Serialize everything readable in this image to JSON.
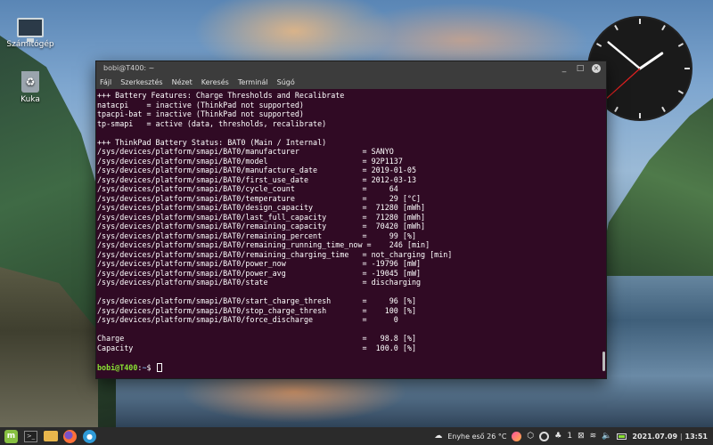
{
  "desktop": {
    "icons": [
      {
        "label": "Számítógép",
        "icon": "computer-icon"
      },
      {
        "label": "Kuka",
        "icon": "trash-icon"
      }
    ]
  },
  "window": {
    "title": "bobi@T400: ~",
    "controls": {
      "minimize": "_",
      "maximize": "□",
      "close": "×"
    },
    "menu": [
      "Fájl",
      "Szerkesztés",
      "Nézet",
      "Keresés",
      "Terminál",
      "Súgó"
    ]
  },
  "terminal": {
    "lines": [
      "+++ Battery Features: Charge Thresholds and Recalibrate",
      "natacpi    = inactive (ThinkPad not supported)",
      "tpacpi-bat = inactive (ThinkPad not supported)",
      "tp-smapi   = active (data, thresholds, recalibrate)",
      "",
      "+++ ThinkPad Battery Status: BAT0 (Main / Internal)",
      "/sys/devices/platform/smapi/BAT0/manufacturer              = SANYO",
      "/sys/devices/platform/smapi/BAT0/model                     = 92P1137",
      "/sys/devices/platform/smapi/BAT0/manufacture_date          = 2019-01-05",
      "/sys/devices/platform/smapi/BAT0/first_use_date            = 2012-03-13",
      "/sys/devices/platform/smapi/BAT0/cycle_count               =     64",
      "/sys/devices/platform/smapi/BAT0/temperature               =     29 [°C]",
      "/sys/devices/platform/smapi/BAT0/design_capacity           =  71280 [mWh]",
      "/sys/devices/platform/smapi/BAT0/last_full_capacity        =  71280 [mWh]",
      "/sys/devices/platform/smapi/BAT0/remaining_capacity        =  70420 [mWh]",
      "/sys/devices/platform/smapi/BAT0/remaining_percent         =     99 [%]",
      "/sys/devices/platform/smapi/BAT0/remaining_running_time_now =    246 [min]",
      "/sys/devices/platform/smapi/BAT0/remaining_charging_time   = not_charging [min]",
      "/sys/devices/platform/smapi/BAT0/power_now                 = -19796 [mW]",
      "/sys/devices/platform/smapi/BAT0/power_avg                 = -19045 [mW]",
      "/sys/devices/platform/smapi/BAT0/state                     = discharging",
      "",
      "/sys/devices/platform/smapi/BAT0/start_charge_thresh       =     96 [%]",
      "/sys/devices/platform/smapi/BAT0/stop_charge_thresh        =    100 [%]",
      "/sys/devices/platform/smapi/BAT0/force_discharge           =      0",
      "",
      "Charge                                                     =   98.8 [%]",
      "Capacity                                                   =  100.0 [%]",
      ""
    ],
    "prompt": {
      "user_host": "bobi@T400",
      "path": "~",
      "symbol": "$ "
    }
  },
  "taskbar": {
    "apps": [
      {
        "name": "menu",
        "icon": "mint-menu-icon",
        "glyph": "m"
      },
      {
        "name": "terminal",
        "icon": "terminal-icon",
        "glyph": ">_"
      },
      {
        "name": "files",
        "icon": "folder-icon"
      },
      {
        "name": "firefox",
        "icon": "firefox-icon"
      },
      {
        "name": "chat",
        "icon": "chat-icon",
        "glyph": "●"
      }
    ],
    "weather": "Enyhe eső 26 °C",
    "tray_count": "1",
    "tray_glyphs": {
      "cloud": "☁",
      "shield": "⬡",
      "bell": "♣",
      "wifi": "≋",
      "volume": "🔈",
      "vpn": "⊠"
    },
    "datetime": "2021.07.09",
    "time": "13:51",
    "separator": "|"
  },
  "clock": {
    "hour": 13,
    "minute": 51,
    "second": 38
  }
}
